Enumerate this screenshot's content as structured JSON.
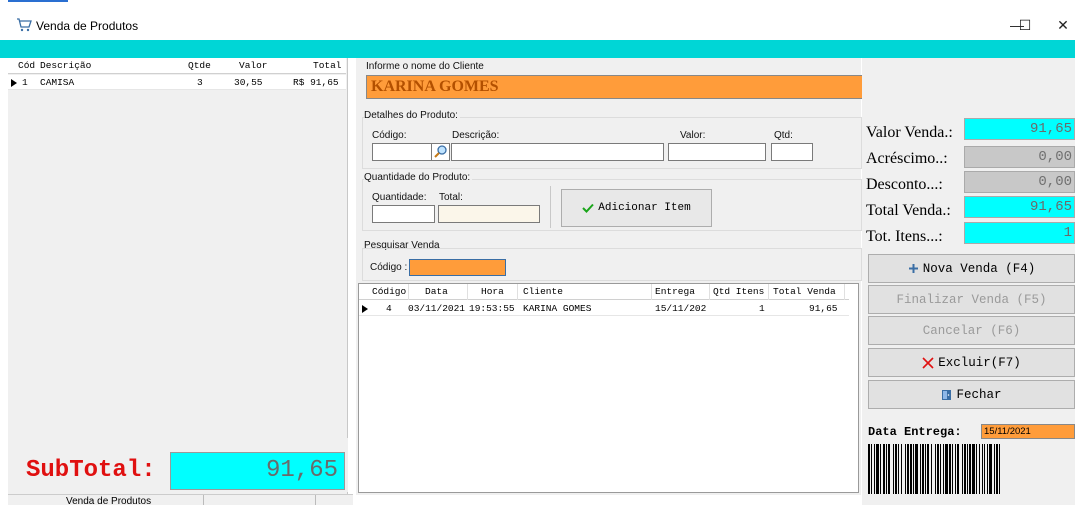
{
  "window": {
    "title": "Venda de Produtos",
    "minimize": "—",
    "maximize": "☐",
    "close": "✕"
  },
  "items_grid": {
    "columns": [
      "Cód",
      "Descrição",
      "Qtde",
      "Valor",
      "Total"
    ],
    "rows": [
      {
        "cod": "1",
        "descricao": "CAMISA",
        "qtde": "3",
        "valor": "30,55",
        "total": "R$ 91,65"
      }
    ]
  },
  "subtotal": {
    "label": "SubTotal:",
    "value": "91,65"
  },
  "status_bar": {
    "text": "Venda de Produtos"
  },
  "cliente": {
    "group_title": "Informe o nome do Cliente",
    "value": "KARINA GOMES"
  },
  "detalhes": {
    "group_title": "Detalhes do Produto:",
    "codigo_label": "Código:",
    "descricao_label": "Descrição:",
    "valor_label": "Valor:",
    "qtd_label": "Qtd:"
  },
  "quantidade": {
    "group_title": "Quantidade do Produto:",
    "quantidade_label": "Quantidade:",
    "total_label": "Total:",
    "add_button": "Adicionar Item"
  },
  "pesquisa": {
    "group_title": "Pesquisar Venda",
    "codigo_label": "Código :",
    "columns": [
      "Código",
      "Data",
      "Hora",
      "Cliente",
      "Entrega",
      "Qtd Itens",
      "Total Venda"
    ],
    "rows": [
      {
        "codigo": "4",
        "data": "03/11/2021",
        "hora": "19:53:55",
        "cliente": "KARINA GOMES",
        "entrega": "15/11/202",
        "qtd_itens": "1",
        "total_venda": "91,65"
      }
    ]
  },
  "totals": {
    "valor_venda_label": "Valor Venda.:",
    "valor_venda": "91,65",
    "acrescimo_label": "Acréscimo..:",
    "acrescimo": "0,00",
    "desconto_label": "Desconto...:",
    "desconto": "0,00",
    "total_venda_label": "Total Venda.:",
    "total_venda": "91,65",
    "tot_itens_label": "Tot. Itens...:",
    "tot_itens": "1"
  },
  "actions": {
    "nova_venda": "Nova Venda (F4)",
    "finalizar": "Finalizar Venda (F5)",
    "cancelar": "Cancelar (F6)",
    "excluir": "Excluir(F7)",
    "fechar": "Fechar"
  },
  "entrega": {
    "label": "Data Entrega:",
    "value": "15/11/2021"
  },
  "colors": {
    "teal": "#00d6d6",
    "cyan": "#00ffff",
    "orange": "#ff9c3a",
    "red": "#e01010",
    "green": "#1aa51a"
  },
  "icons": [
    "cart-icon",
    "play-row-icon",
    "magnifier-icon",
    "checkmark-icon",
    "plus-icon",
    "x-icon",
    "door-icon",
    "barcode-icon"
  ]
}
